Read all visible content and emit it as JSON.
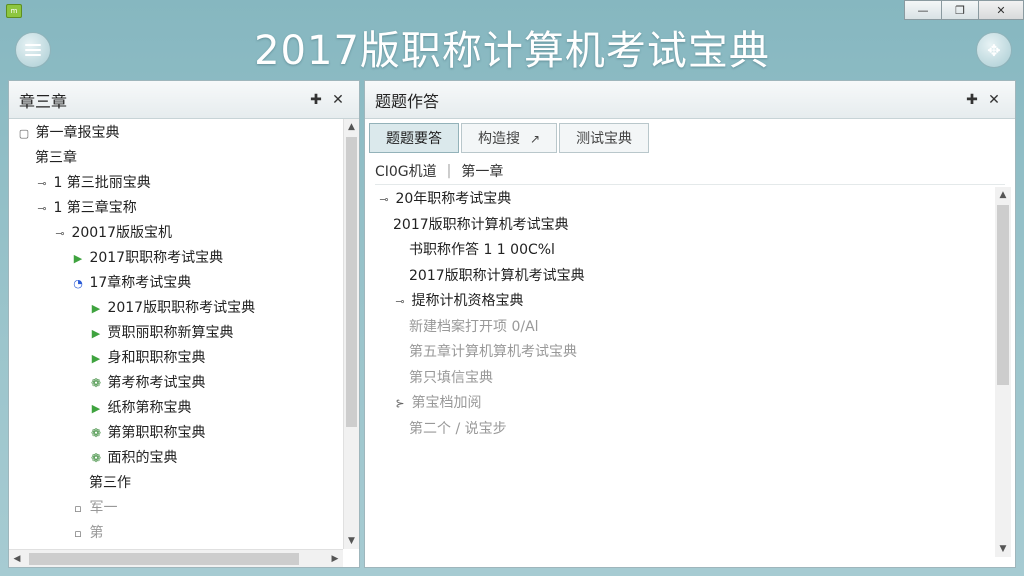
{
  "window": {
    "title": "2017版职称计算机考试宝典",
    "controls": {
      "minimize": "—",
      "maximize": "❐",
      "close": "✕"
    }
  },
  "icons": {
    "menu": "menu-icon",
    "tool": "compress-icon",
    "app": "app-icon"
  },
  "left_panel": {
    "title": "章三章",
    "tree": [
      {
        "label": "第一章报宝典",
        "indent": 0,
        "glyph": "▢",
        "style": ""
      },
      {
        "label": "第三章",
        "indent": 1,
        "glyph": "",
        "style": ""
      },
      {
        "label": "1 第三批丽宝典",
        "indent": 1,
        "glyph": "⊸",
        "style": ""
      },
      {
        "label": "1 第三章宝称",
        "indent": 1,
        "glyph": "⊸",
        "style": ""
      },
      {
        "label": "20017版版宝机",
        "indent": 2,
        "glyph": "⊸",
        "style": ""
      },
      {
        "label": "2017职职称考试宝典",
        "indent": 3,
        "glyph": "▶",
        "style": "tri"
      },
      {
        "label": "17章称考试宝典",
        "indent": 3,
        "glyph": "◔",
        "style": "blue"
      },
      {
        "label": "2017版职职称考试宝典",
        "indent": 4,
        "glyph": "▶",
        "style": "tri"
      },
      {
        "label": "贾职丽职称新算宝典",
        "indent": 4,
        "glyph": "▶",
        "style": "tri"
      },
      {
        "label": "身和职职称宝典",
        "indent": 4,
        "glyph": "▶",
        "style": "tri"
      },
      {
        "label": "第考称考试宝典",
        "indent": 4,
        "glyph": "❁",
        "style": "leaf"
      },
      {
        "label": "纸称第称宝典",
        "indent": 4,
        "glyph": "▶",
        "style": "tri"
      },
      {
        "label": "第第职职称宝典",
        "indent": 4,
        "glyph": "❁",
        "style": "leaf"
      },
      {
        "label": "面积的宝典",
        "indent": 4,
        "glyph": "❁",
        "style": "leaf"
      },
      {
        "label": "第三作",
        "indent": 4,
        "glyph": "",
        "style": ""
      },
      {
        "label": "军一",
        "indent": 3,
        "glyph": "▫",
        "style": "faded"
      },
      {
        "label": "第",
        "indent": 3,
        "glyph": "▫",
        "style": "faded"
      }
    ]
  },
  "right_panel": {
    "title": "题题作答",
    "tabs": [
      {
        "label": "题题要答",
        "active": true
      },
      {
        "label": "构造搜",
        "active": false,
        "chev": "↗"
      },
      {
        "label": "测试宝典",
        "active": false
      }
    ],
    "breadcrumb": [
      "CI0G机道",
      "第一章"
    ],
    "tree": [
      {
        "label": "20年职称考试宝典",
        "indent": 0,
        "glyph": "⊸",
        "style": ""
      },
      {
        "label": "2017版职称计算机考试宝典",
        "indent": 1,
        "glyph": "",
        "style": ""
      },
      {
        "label": "书职称作答  1 1 00C%l",
        "indent": 2,
        "glyph": "",
        "style": ""
      },
      {
        "label": "2017版职称计算机考试宝典",
        "indent": 2,
        "glyph": "",
        "style": ""
      },
      {
        "label": "提称计机资格宝典",
        "indent": 1,
        "glyph": "⊸",
        "style": ""
      },
      {
        "label": "新建档案打开项 0/Al",
        "indent": 2,
        "glyph": "",
        "style": "faded"
      },
      {
        "label": "第五章计算机算机考试宝典",
        "indent": 2,
        "glyph": "",
        "style": "faded"
      },
      {
        "label": "第只填信宝典",
        "indent": 2,
        "glyph": "",
        "style": "faded"
      },
      {
        "label": "第宝档加阅",
        "indent": 1,
        "glyph": "⊱",
        "style": "faded"
      },
      {
        "label": "第二个 / 说宝步",
        "indent": 2,
        "glyph": "",
        "style": "faded"
      }
    ]
  },
  "panel_controls": {
    "pin": "✚",
    "close": "✕"
  }
}
